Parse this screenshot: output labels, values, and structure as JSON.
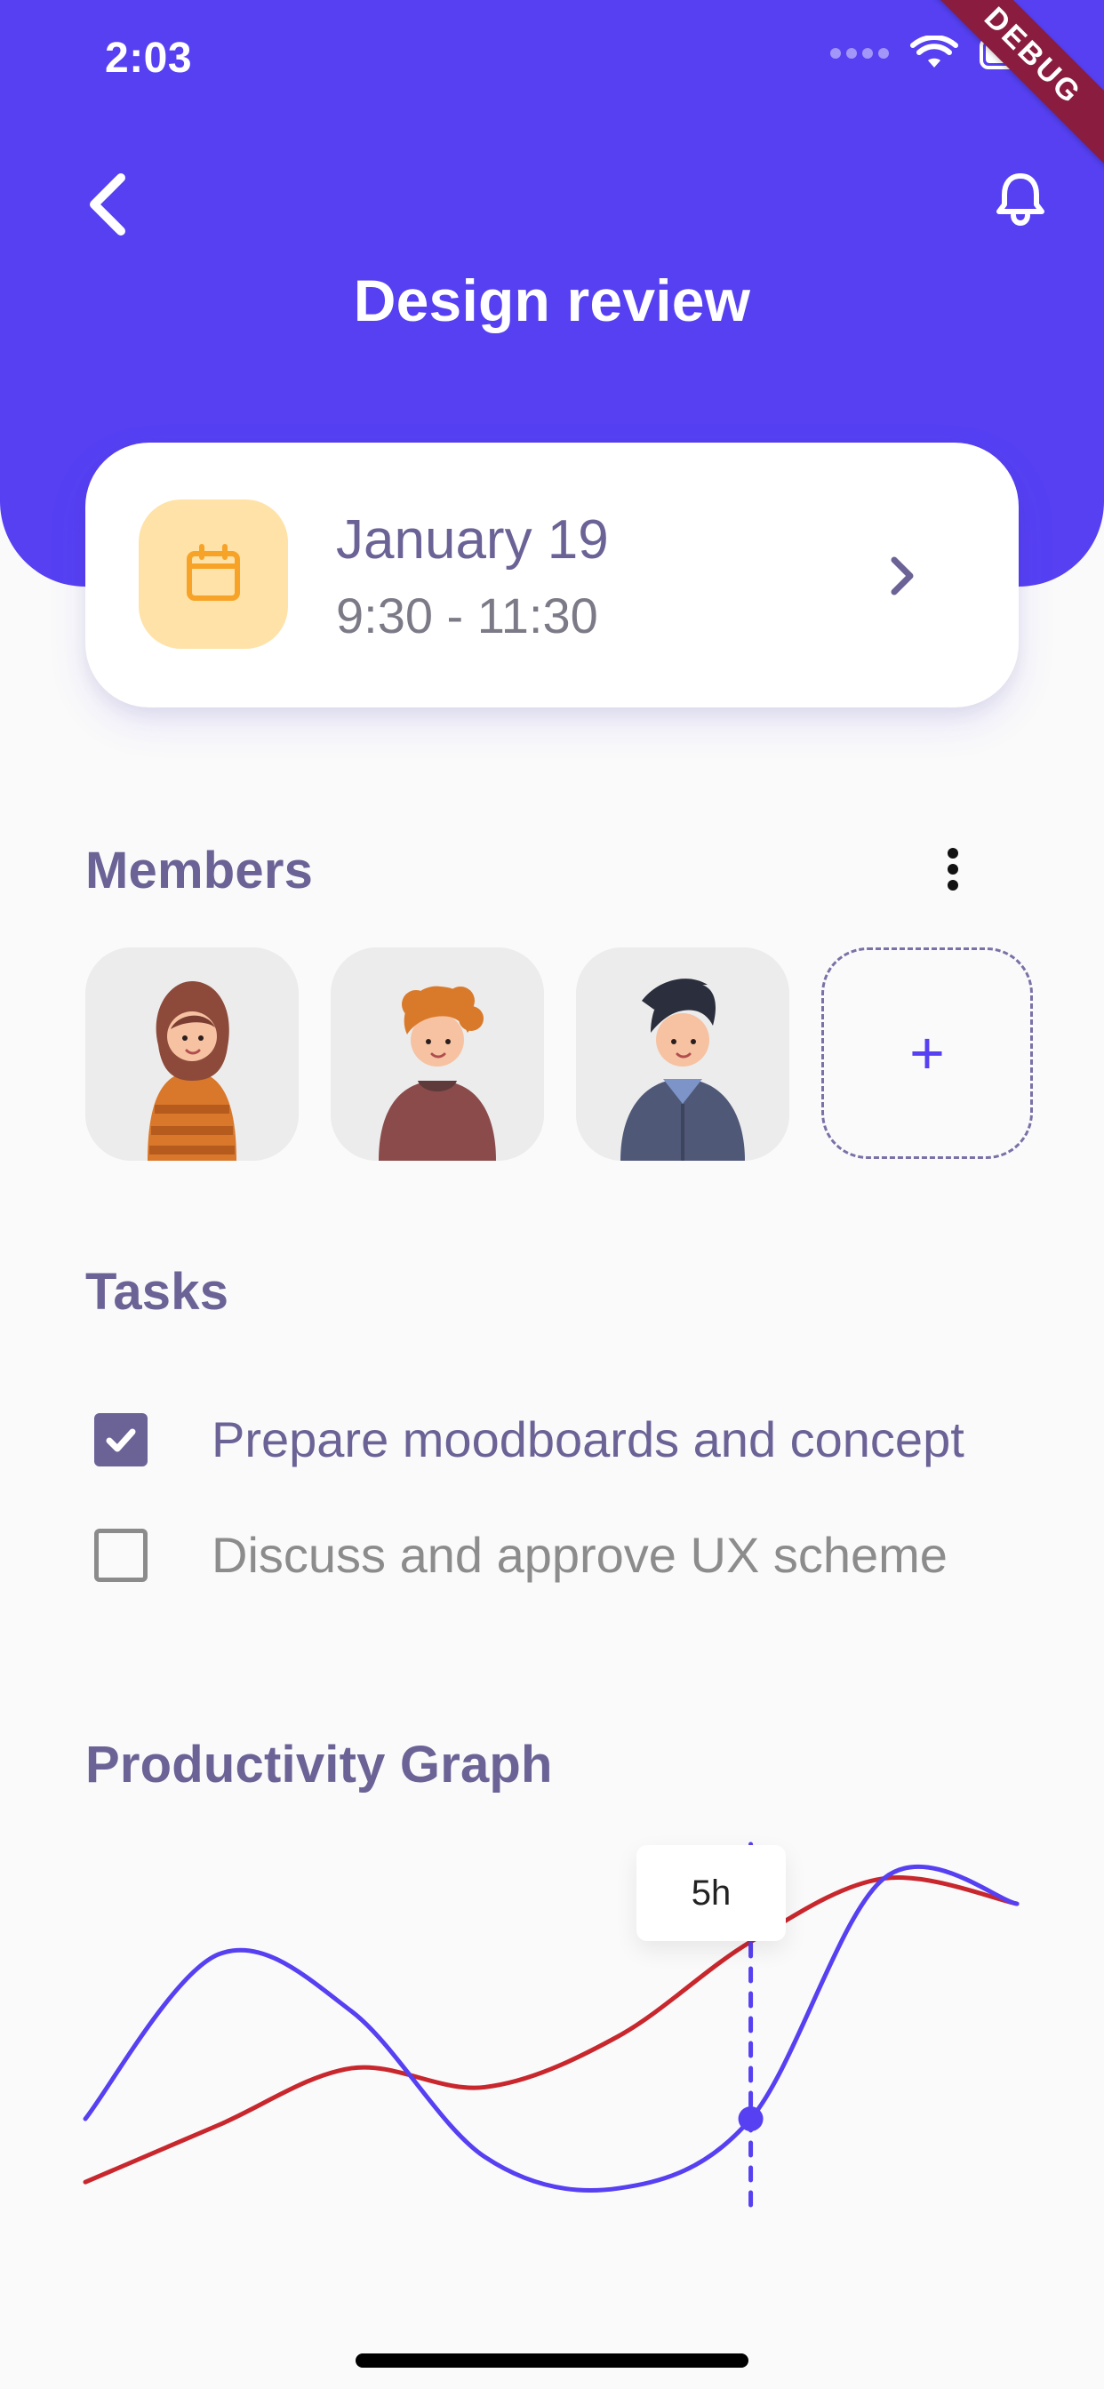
{
  "status_bar": {
    "time": "2:03"
  },
  "debug_banner": {
    "label": "DEBUG"
  },
  "header": {
    "title": "Design review",
    "back_icon": "chevron-left-icon",
    "notification_icon": "bell-icon",
    "accent": "#5640F2"
  },
  "date_card": {
    "date": "January 19",
    "time_range": "9:30 - 11:30",
    "icon": "calendar-icon",
    "badge_color": "#FFE2A7",
    "icon_color": "#F7A328"
  },
  "members": {
    "title": "Members",
    "more_icon": "more-vertical-icon",
    "items": [
      {
        "avatar": "woman-orange-striped-sweater"
      },
      {
        "avatar": "man-curly-ginger-hair"
      },
      {
        "avatar": "man-dark-hair-denim-shirt"
      }
    ],
    "add_button_label": "+"
  },
  "tasks": {
    "title": "Tasks",
    "items": [
      {
        "label": "Prepare moodboards and concept",
        "checked": true
      },
      {
        "label": "Discuss and approve UX scheme",
        "checked": false
      }
    ]
  },
  "chart_data": {
    "type": "line",
    "title": "Productivity Graph",
    "series": [
      {
        "color": "#5640F2",
        "values": [
          3.2,
          5.8,
          4.9,
          2.6,
          2.1,
          3.2,
          7.0,
          6.6
        ]
      },
      {
        "color": "#C8272D",
        "values": [
          2.2,
          3.1,
          4.0,
          3.7,
          4.5,
          6.0,
          7.0,
          6.6
        ]
      }
    ],
    "x": [
      0,
      1,
      2,
      3,
      4,
      5,
      6,
      7
    ],
    "ylim": [
      1.5,
      7.5
    ],
    "highlight": {
      "series_index": 0,
      "x_index": 5,
      "label": "5h"
    },
    "grid": false,
    "legend": "none"
  }
}
